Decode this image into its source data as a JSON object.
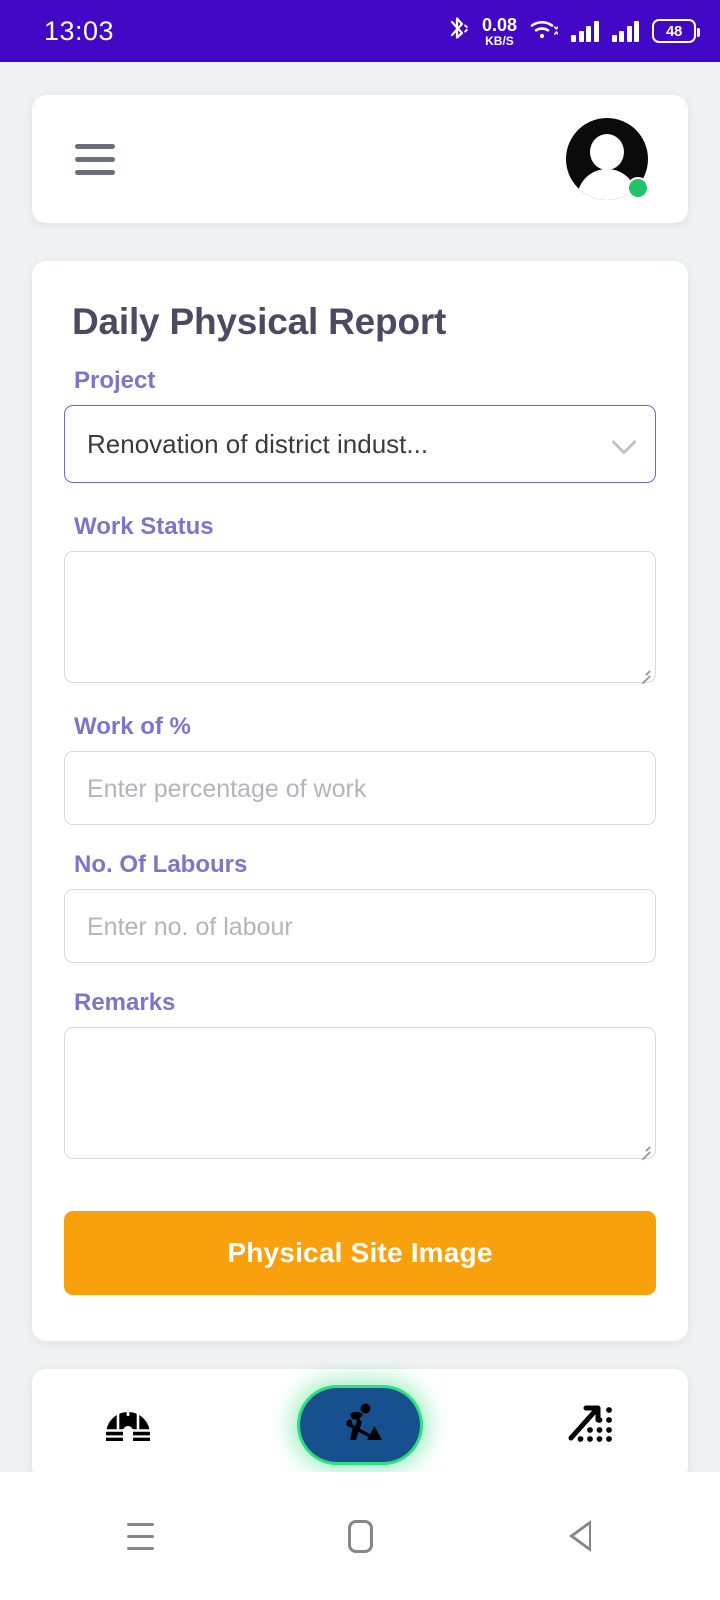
{
  "status_bar": {
    "time": "13:03",
    "bluetooth_icon": "bluetooth-icon",
    "net_speed_value": "0.08",
    "net_speed_unit": "KB/S",
    "wifi_icon": "wifi-icon",
    "signal_icon_1": "signal-bars-icon",
    "signal_icon_2": "signal-bars-icon",
    "battery_level": "48",
    "background_color": "#4208c6"
  },
  "header": {
    "menu_icon": "hamburger-menu-icon",
    "avatar_icon": "user-avatar-icon",
    "status_dot_color": "#23c268"
  },
  "form": {
    "title": "Daily Physical Report",
    "project": {
      "label": "Project",
      "value": "Renovation of district indust...",
      "chevron_icon": "chevron-down-icon"
    },
    "work_status": {
      "label": "Work Status",
      "value": ""
    },
    "work_percent": {
      "label": "Work of %",
      "value": "",
      "placeholder": "Enter percentage of work"
    },
    "labours": {
      "label": "No. Of Labours",
      "value": "",
      "placeholder": "Enter no. of labour"
    },
    "remarks": {
      "label": "Remarks",
      "value": ""
    },
    "submit_button": {
      "label": "Physical Site Image",
      "color": "#f9a10c"
    },
    "label_color": "#7b76cc",
    "title_color": "#4c4a63"
  },
  "bottom_nav": {
    "items": [
      {
        "name": "igloo-icon",
        "active": false
      },
      {
        "name": "construction-worker-icon",
        "active": true
      },
      {
        "name": "trending-up-dots-icon",
        "active": false
      }
    ],
    "active_background": "#16508f",
    "active_glow": "#2ddd7f"
  },
  "android_nav": {
    "recents_icon": "recents-icon",
    "home_icon": "home-icon",
    "back_icon": "back-icon"
  }
}
